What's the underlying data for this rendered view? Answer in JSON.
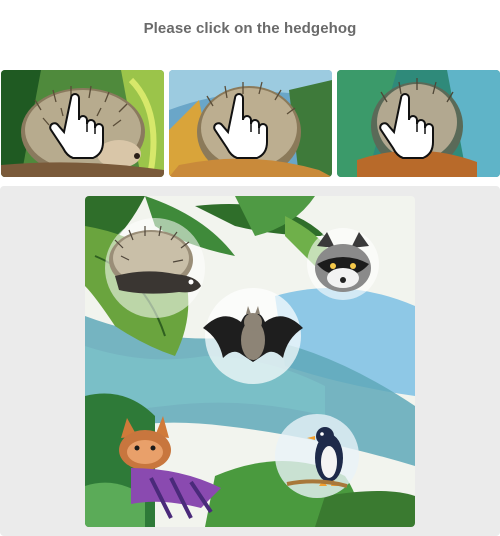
{
  "challenge": {
    "prompt": "Please click on the hedgehog"
  },
  "examples": [
    {
      "name": "example-hedgehog-1",
      "icon": "hand-pointer-cursor"
    },
    {
      "name": "example-hedgehog-2",
      "icon": "hand-pointer-cursor"
    },
    {
      "name": "example-hedgehog-3",
      "icon": "hand-pointer-cursor"
    }
  ],
  "scene": {
    "tokens": [
      {
        "animal": "hedgehog"
      },
      {
        "animal": "raccoon"
      },
      {
        "animal": "bat"
      },
      {
        "animal": "cat"
      },
      {
        "animal": "penguin"
      }
    ]
  },
  "colors": {
    "prompt_text": "#6a6a6a",
    "stage_background": "#ebebeb",
    "leaf_green": "#3f8a3a",
    "water_blue": "#6fb6da"
  }
}
